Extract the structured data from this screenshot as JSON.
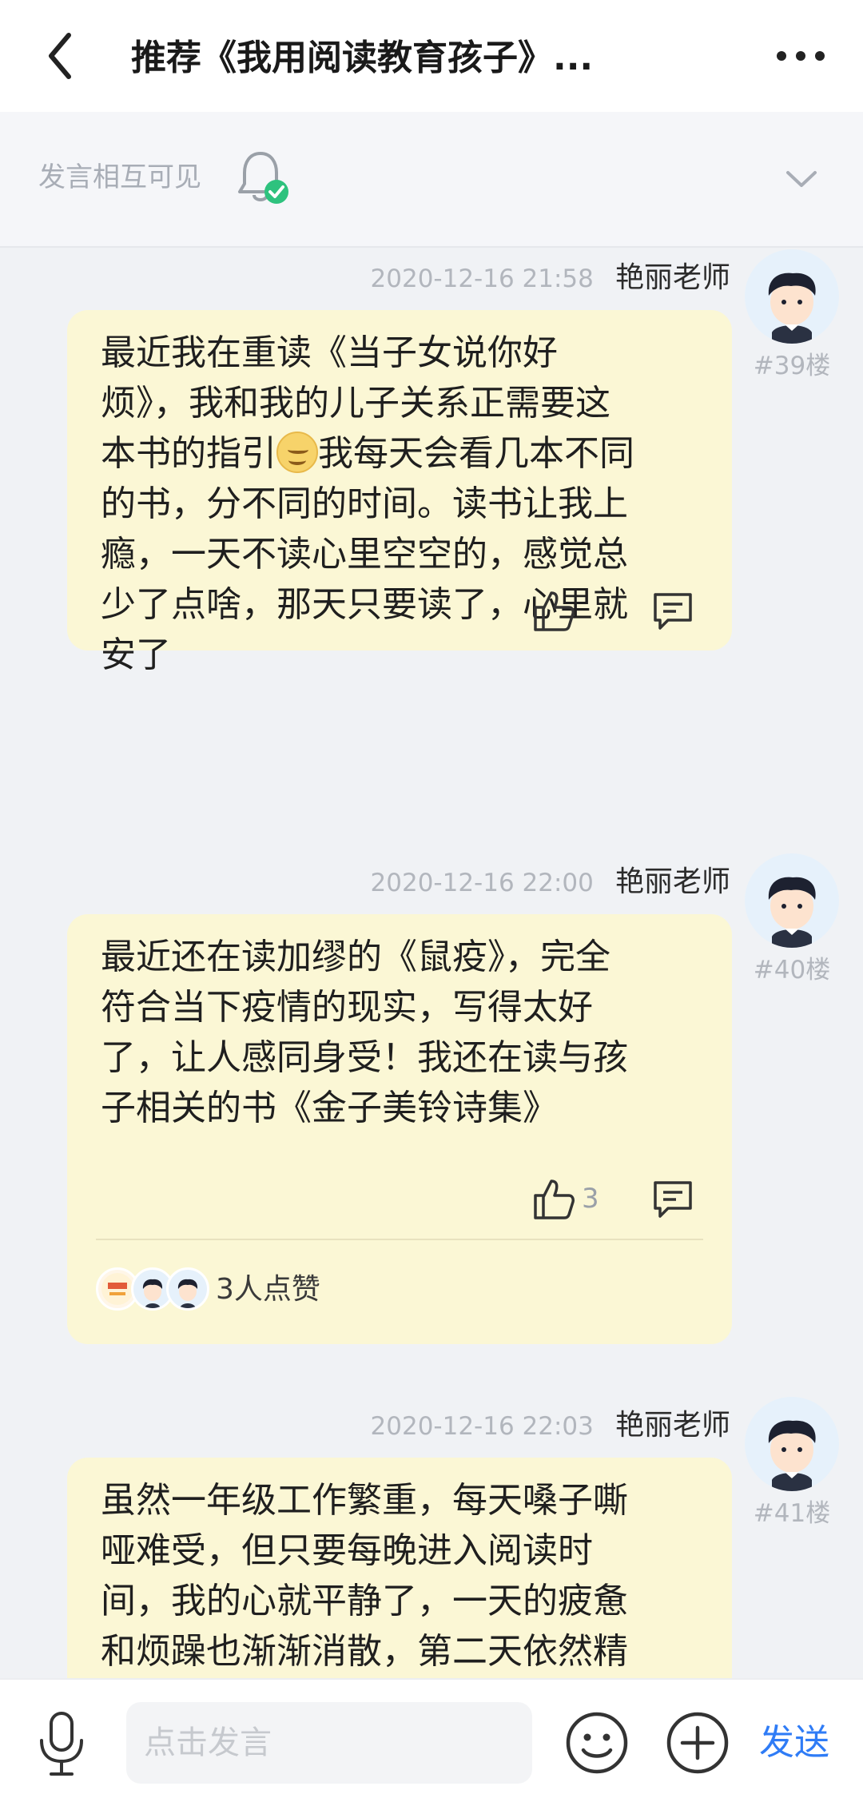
{
  "header": {
    "title": "推荐《我用阅读教育孩子》..."
  },
  "notice": {
    "text": "发言相互可见"
  },
  "posts": [
    {
      "time": "2020-12-16 21:58",
      "author": "艳丽老师",
      "floor": "#39楼",
      "text_before_emoji": "最近我在重读《当子女说你好\n烦》，我和我的儿子关系正需要这\n本书的指引",
      "text_after_emoji": "我每天会看几本不同\n的书，分不同的时间。读书让我上\n瘾，一天不读心里空空的，感觉总\n少了点啥，那天只要读了，心里就\n安了",
      "emoji": "smile-emoji"
    },
    {
      "time": "2020-12-16 22:00",
      "author": "艳丽老师",
      "floor": "#40楼",
      "text": "最近还在读加缪的《鼠疫》，完全\n符合当下疫情的现实，写得太好\n了，让人感同身受！我还在读与孩\n子相关的书《金子美铃诗集》",
      "like_count": "3",
      "likers_text": "3人点赞"
    },
    {
      "time": "2020-12-16 22:03",
      "author": "艳丽老师",
      "floor": "#41楼",
      "text": "虽然一年级工作繁重，每天嗓子嘶\n哑难受，但只要每晚进入阅读时\n间，我的心就平静了，一天的疲惫\n和烦躁也渐渐消散，第二天依然精"
    }
  ],
  "composer": {
    "placeholder": "点击发言",
    "send_label": "发送"
  },
  "colors": {
    "bubble": "#fbf7d5",
    "accent": "#2f7cf6",
    "check": "#2ec27e"
  }
}
